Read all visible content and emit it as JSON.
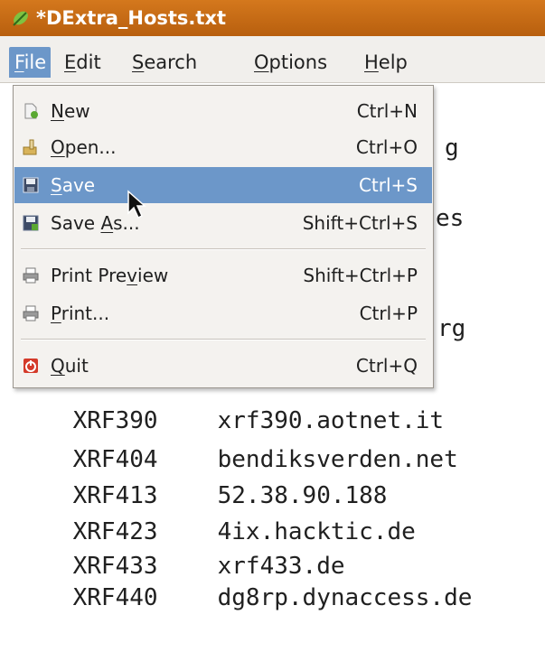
{
  "window": {
    "title": "*DExtra_Hosts.txt"
  },
  "menubar": {
    "items": [
      {
        "pre": "",
        "key": "F",
        "post": "ile"
      },
      {
        "pre": "",
        "key": "E",
        "post": "dit"
      },
      {
        "pre": "",
        "key": "S",
        "post": "earch"
      },
      {
        "pre": "",
        "key": "O",
        "post": "ptions"
      },
      {
        "pre": "",
        "key": "H",
        "post": "elp"
      }
    ]
  },
  "file_menu": {
    "items": [
      {
        "pre": "",
        "key": "N",
        "post": "ew",
        "shortcut": "Ctrl+N",
        "icon": "new-file-icon"
      },
      {
        "pre": "",
        "key": "O",
        "post": "pen...",
        "shortcut": "Ctrl+O",
        "icon": "open-folder-icon"
      },
      {
        "pre": "",
        "key": "S",
        "post": "ave",
        "shortcut": "Ctrl+S",
        "icon": "floppy-disk-icon",
        "active": true
      },
      {
        "pre": "Save ",
        "key": "A",
        "post": "s...",
        "shortcut": "Shift+Ctrl+S",
        "icon": "save-as-icon"
      },
      {
        "pre": "Print Pre",
        "key": "v",
        "post": "iew",
        "shortcut": "Shift+Ctrl+P",
        "icon": "print-preview-icon"
      },
      {
        "pre": "",
        "key": "P",
        "post": "rint...",
        "shortcut": "Ctrl+P",
        "icon": "printer-icon"
      },
      {
        "pre": "",
        "key": "Q",
        "post": "uit",
        "shortcut": "Ctrl+Q",
        "icon": "quit-icon"
      }
    ]
  },
  "editor": {
    "peek": [
      "g",
      "es",
      "rg"
    ],
    "lines": [
      {
        "id": "XRF390",
        "host": "xrf390.aotnet.it"
      },
      {
        "id": "XRF404",
        "host": "bendiksverden.net"
      },
      {
        "id": "XRF413",
        "host": "52.38.90.188"
      },
      {
        "id": "XRF423",
        "host": "4ix.hacktic.de"
      },
      {
        "id": "XRF433",
        "host": "xrf433.de"
      },
      {
        "id": "XRF440",
        "host": "dg8rp.dynaccess.de"
      }
    ]
  },
  "colors": {
    "titlebar": "#c96c16",
    "highlight": "#6c97c9"
  }
}
